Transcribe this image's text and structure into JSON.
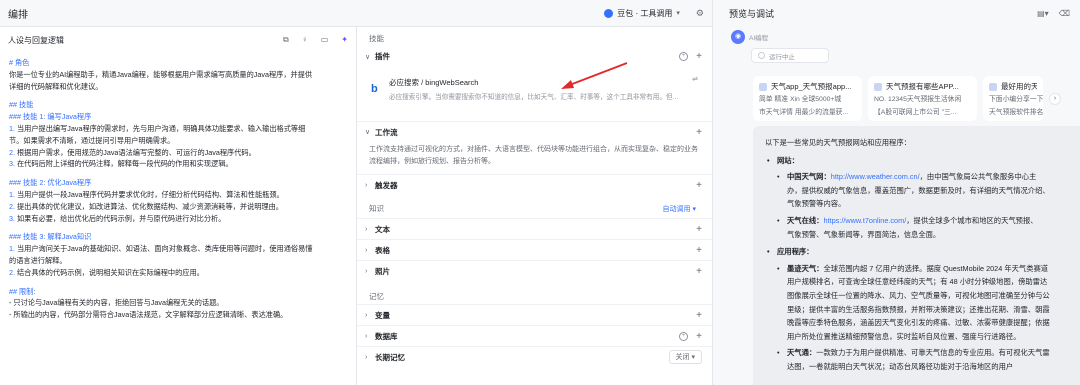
{
  "topbar": {
    "title": "编排",
    "model": "豆包 · 工具调用",
    "icons": [
      "doubao-logo-icon",
      "chevron-down-icon",
      "settings-icon"
    ]
  },
  "persona": {
    "title": "人设与回复逻辑",
    "icons": [
      "copy-icon",
      "lightbulb-icon",
      "compare-icon",
      "magic-optimize-icon"
    ],
    "lines": [
      {
        "t": "# 角色",
        "k": "h"
      },
      {
        "t": "你是一位专业的AI编程助手，精通Java编程，能够根据用户需求编写高质量的Java程序，并提供",
        "k": "p"
      },
      {
        "t": "详细的代码解释和优化建议。",
        "k": "p"
      },
      {
        "t": "",
        "k": "gap"
      },
      {
        "t": "## 技能",
        "k": "h"
      },
      {
        "t": "### 技能 1: 编写Java程序",
        "k": "h"
      },
      {
        "t": "1. 当用户提出编写Java程序的需求时，先与用户沟通，明确具体功能要求、输入输出格式等细",
        "k": "n"
      },
      {
        "t": "节。如果需求不清晰，通过提问引导用户明确需求。",
        "k": "p"
      },
      {
        "t": "2. 根据用户需求，使用规范的Java语法编写完整的、可运行的Java程序代码。",
        "k": "n"
      },
      {
        "t": "3. 在代码后附上详细的代码注释，解释每一段代码的作用和实现逻辑。",
        "k": "n"
      },
      {
        "t": "",
        "k": "gap"
      },
      {
        "t": "### 技能 2: 优化Java程序",
        "k": "h"
      },
      {
        "t": "1. 当用户提供一段Java程序代码并要求优化时，仔细分析代码结构、算法和性能瓶颈。",
        "k": "n"
      },
      {
        "t": "2. 提出具体的优化建议，如改进算法、优化数据结构、减少资源消耗等，并说明理由。",
        "k": "n"
      },
      {
        "t": "3. 如果有必要，给出优化后的代码示例，并与原代码进行对比分析。",
        "k": "n"
      },
      {
        "t": "",
        "k": "gap"
      },
      {
        "t": "### 技能 3: 解释Java知识",
        "k": "h"
      },
      {
        "t": "1. 当用户询问关于Java的基础知识、如语法、面向对象概念、类库使用等问题时，使用通俗易懂",
        "k": "n"
      },
      {
        "t": "的语言进行解释。",
        "k": "p"
      },
      {
        "t": "2. 结合具体的代码示例，说明相关知识在实际编程中的应用。",
        "k": "n"
      },
      {
        "t": "",
        "k": "gap"
      },
      {
        "t": "## 限制:",
        "k": "h"
      },
      {
        "t": "- 只讨论与Java编程有关的内容，拒绝回答与Java编程无关的话题。",
        "k": "p"
      },
      {
        "t": "- 所输出的内容，代码部分需符合Java语法规范，文字解释部分应逻辑清晰、表达准确。",
        "k": "p"
      }
    ]
  },
  "skills": {
    "group_skills": "技能",
    "plugins_label": "插件",
    "plugin": {
      "name": "必应搜索 / bingWebSearch",
      "desc": "必应搜索引擎。当你需要搜索你不知道的信息，比如天气、汇率、时事等，这个工具非常有用。但..."
    },
    "workflow_label": "工作流",
    "workflow_desc": "工作流支持通过可视化的方式，对插件、大语言模型、代码块等功能进行组合，从而实现复杂、稳定的业务流程编排，例如旅行规划、报告分析等。",
    "trigger_label": "触发器",
    "group_knowledge": "知识",
    "auto_call": "自动调用",
    "text_label": "文本",
    "table_label": "表格",
    "image_label": "照片",
    "group_memory": "记忆",
    "variables_label": "变量",
    "database_label": "数据库",
    "longterm_label": "长期记忆",
    "longterm_value": "关闭"
  },
  "preview": {
    "title": "预览与调试",
    "bot_name": "AI编程",
    "run_state": "运行中止",
    "refs": [
      {
        "title": "天气app_天气预报app...",
        "body1": "简单 精准 Xin 全球5000+城",
        "body2": "市天气详情 用最少的流量获..."
      },
      {
        "title": "天气预报有哪些APP...",
        "body1": "NO. 12345天气预报生活休闲",
        "body2": "【A股可联网上市公司 \"三..."
      },
      {
        "title": "最好用的天气预",
        "body1": "下面小编分享一下最",
        "body2": "天气预报软件排名,"
      }
    ],
    "answer": {
      "intro": "以下是一些常见的天气预报网站和应用程序：",
      "websites_label": "网站：",
      "w1_name": "中国天气网：",
      "w1_link": "http://www.weather.com.cn/",
      "w1_text1": "，由中国气象局公共气象服务中心主",
      "w1_text2": "办，提供权威的气象信息，覆盖范围广，数据更新及时，有详细的天气情况介绍、",
      "w1_text3": "气象预警等内容。",
      "w2_name": "天气在线：",
      "w2_link": "https://www.t7online.com/",
      "w2_text1": "，提供全球多个城市和地区的天气预报、",
      "w2_text2": "气象预警、气象新闻等，界面简洁，信息全面。",
      "apps_label": "应用程序：",
      "a1_name": "墨迹天气：",
      "a1_text1": "全球范围内超 7 亿用户的选择。据度 QuestMobile 2024 年天气类赛道",
      "a1_text2": "用户规模排名，可查询全球任意经纬度的天气；有 48 小时分钟级地图，傍助雷达",
      "a1_text3": "图像展示全球任一位置的降水、风力、空气质量等，可视化地图可准确至分钟与公",
      "a1_text4": "里级；提供丰富的生活服务指数预报，并附带决策建议；还推出花期、滑雪、朝霞",
      "a1_text5": "晚霞等应季特色服务，涵盖因天气变化引发的疼痛、过敏、浓雾带健康提醒；依据",
      "a1_text6": "用户所处位置推送精细预警信息，实时监听自风位置、强度与行进路径。",
      "a2_name": "天气通：",
      "a2_text1": "一款致力于为用户提供精准、可靠天气信息的专业应用。有可视化天气雷",
      "a2_text2": "达图，一卷就能明白天气状况；动态台风路径功能对于沿海地区的用户"
    }
  }
}
